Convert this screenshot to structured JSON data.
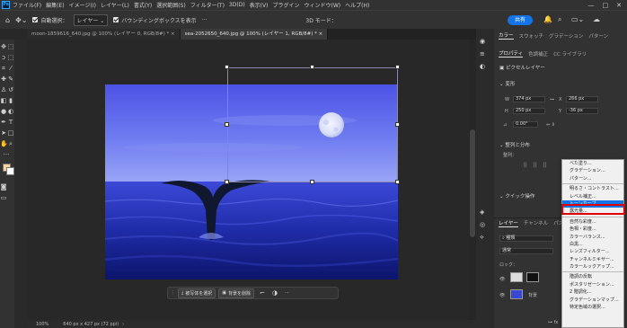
{
  "menubar": {
    "logo": "Ps",
    "items": [
      "ファイル(F)",
      "編集(E)",
      "イメージ(I)",
      "レイヤー(L)",
      "書式(Y)",
      "選択範囲(S)",
      "フィルター(T)",
      "3D(D)",
      "表示(V)",
      "プラグイン",
      "ウィンドウ(W)",
      "ヘルプ(H)"
    ],
    "window_buttons": [
      "—",
      "□",
      "✕"
    ]
  },
  "options": {
    "auto_select_label": "自動選択：",
    "auto_select_value": "レイヤー ⌄",
    "bbox_label": "バウンディングボックスを表示",
    "more": "···",
    "share_label": "共有",
    "mode_3d": "3D モード："
  },
  "tabs": [
    {
      "label": "moon-1859616_640.jpg @ 100% (レイヤー 0, RGB/8#) *  ×",
      "active": false
    },
    {
      "label": "sea-2052650_640.jpg @ 100% (レイヤー 1, RGB/8#) *  ×",
      "active": true
    }
  ],
  "contextbar": {
    "select_subject": "被写体を選択",
    "remove_bg": "背景を削除",
    "more": "···"
  },
  "status": {
    "zoom": "100%",
    "size": "640 px x 427 px (72 ppi)",
    "arrow": "›"
  },
  "panels": {
    "top_tabs": [
      "カラー",
      "スウォッチ",
      "グラデーション",
      "パターン"
    ],
    "prop_tabs": [
      "プロパティ",
      "色調補正",
      "CC ライブラリ"
    ],
    "pixel_layer": "ピクセルレイヤー",
    "transform_title": "変形",
    "w_label": "W",
    "w_value": "374 px",
    "h_label": "H",
    "h_value": "250 px",
    "x_label": "X",
    "x_value": "266 px",
    "y_label": "Y",
    "y_value": "-36 px",
    "angle_value": "0.00°",
    "align_title": "整列と分布",
    "align_label": "整列：",
    "quick_actions": "クイック操作",
    "layer_tabs": [
      "レイヤー",
      "チャンネル",
      "パス"
    ],
    "kind_label": "種類",
    "blend_mode": "通常",
    "lock_label": "ロック：",
    "bg_layer": "背景"
  },
  "menu": {
    "groups": [
      [
        "べた塗り...",
        "グラデーション...",
        "パターン..."
      ],
      [
        "明るさ・コントラスト...",
        "レベル補正...",
        "トーンカーブ...",
        "露光量..."
      ],
      [
        "自然な彩度...",
        "色相・彩度...",
        "カラーバランス...",
        "白黒...",
        "レンズフィルター...",
        "チャンネルミキサー...",
        "カラールックアップ..."
      ],
      [
        "階調の反転",
        "ポスタリゼーション...",
        "2 階調化...",
        "グラデーションマップ...",
        "特定色域の選択..."
      ]
    ],
    "highlighted": "トーンカーブ..."
  },
  "colors": {
    "accent": "#1473e6",
    "highlight_border": "#e00000",
    "foreground": "#f3d3a8",
    "background": "#ffffff"
  }
}
